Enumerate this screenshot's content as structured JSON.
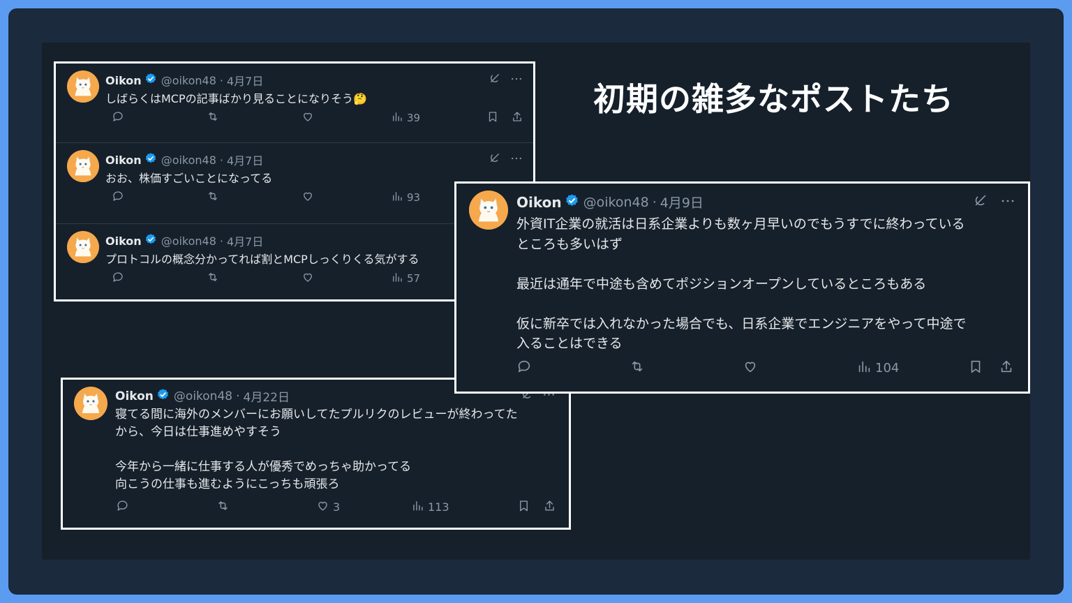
{
  "slide": {
    "title": "初期の雑多なポストたち"
  },
  "colors": {
    "background": "#15202b",
    "frame": "#1c2a3d",
    "outer": "#5b9cf0",
    "verified": "#1d9bf0",
    "avatar": "#f5a84c"
  },
  "author": {
    "name": "Oikon",
    "handle": "@oikon48"
  },
  "posts": [
    {
      "date": "4月7日",
      "text": "しばらくはMCPの記事ばかり見ることになりそう🤔",
      "views": "39"
    },
    {
      "date": "4月7日",
      "text": "おお、株価すごいことになってる",
      "views": "93"
    },
    {
      "date": "4月7日",
      "text": "プロトコルの概念分かってれば割とMCPしっくりくる気がする",
      "views": "57"
    },
    {
      "date": "4月9日",
      "text": "外資IT企業の就活は日系企業よりも数ヶ月早いのでもうすでに終わっている\nところも多いはず\n\n最近は通年で中途も含めてポジションオープンしているところもある\n\n仮に新卒では入れなかった場合でも、日系企業でエンジニアをやって中途で\n入ることはできる",
      "views": "104"
    },
    {
      "date": "4月22日",
      "text": "寝てる間に海外のメンバーにお願いしてたプルリクのレビューが終わってた\nから、今日は仕事進めやすそう\n\n今年から一緒に仕事する人が優秀でめっちゃ助かってる\n向こうの仕事も進むようにこっちも頑張ろ",
      "likes": "3",
      "views": "113"
    }
  ],
  "separator": "·"
}
